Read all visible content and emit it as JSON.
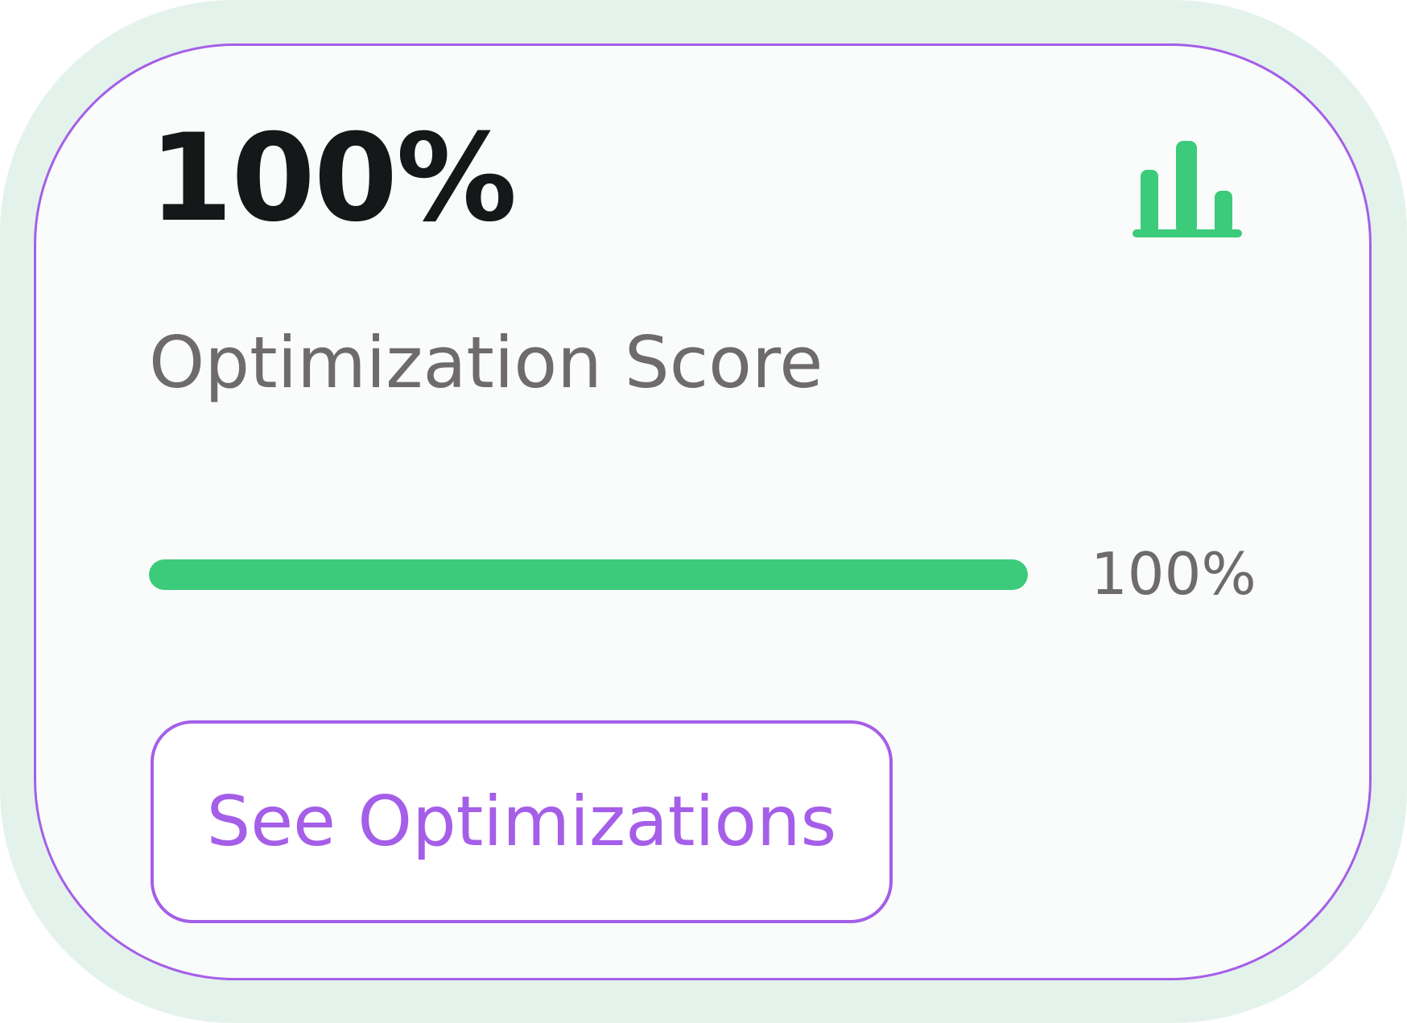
{
  "score": {
    "value_text": "100%",
    "label": "Optimization Score",
    "progress_fraction": 1.0,
    "progress_text": "100%"
  },
  "button": {
    "label": "See Optimizations"
  },
  "icons": {
    "chart": "bar-chart-icon"
  },
  "colors": {
    "accent": "#a55ee8",
    "success": "#3ccb7a",
    "card_background": "#f9fcfb",
    "outer_background": "#e4f2ec",
    "value_text": "#151818",
    "muted_text": "#6e6a6d"
  }
}
